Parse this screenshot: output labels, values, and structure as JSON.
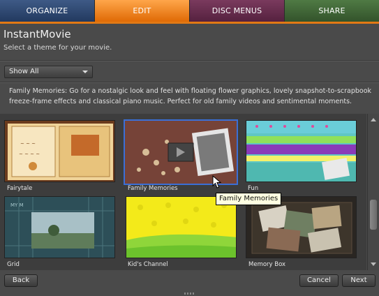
{
  "tabs": [
    {
      "label": "ORGANIZE",
      "color": "#2e4a74"
    },
    {
      "label": "EDIT",
      "color": "#f58a1f",
      "active": true
    },
    {
      "label": "DISC MENUS",
      "color": "#66304f"
    },
    {
      "label": "SHARE",
      "color": "#41673a"
    }
  ],
  "header": {
    "title": "InstantMovie",
    "subtitle": "Select a theme for your movie."
  },
  "filter": {
    "selected": "Show All"
  },
  "description": "Family Memories: Go for a nostalgic look and feel with floating flower graphics, lovely snapshot-to-scrapbook freeze-frame effects and classical piano music. Perfect for old family videos and sentimental moments.",
  "themes": [
    {
      "label": "Fairytale",
      "icon": "storybook-thumbnail"
    },
    {
      "label": "Family Memories",
      "icon": "flower-snapshot-thumbnail",
      "selected": true
    },
    {
      "label": "Fun",
      "icon": "stripes-thumbnail"
    },
    {
      "label": "Grid",
      "icon": "grid-screen-thumbnail"
    },
    {
      "label": "Kid's Channel",
      "icon": "yellow-green-thumbnail"
    },
    {
      "label": "Memory Box",
      "icon": "photos-box-thumbnail"
    }
  ],
  "tooltip": "Family Memories",
  "buttons": {
    "back": "Back",
    "cancel": "Cancel",
    "next": "Next"
  },
  "colors": {
    "selection": "#3b6fd6",
    "accent": "#e27914"
  }
}
